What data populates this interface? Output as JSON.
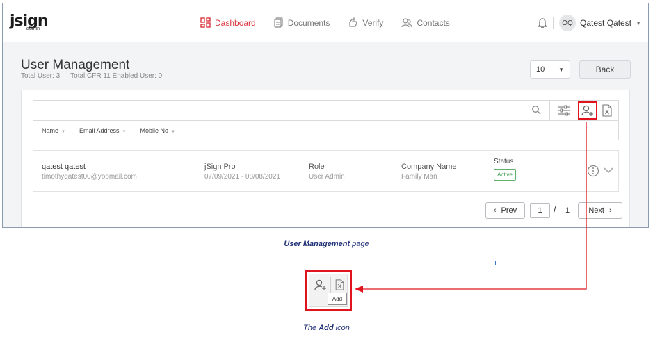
{
  "app": {
    "logo": "jsign",
    "logo_sub": "admin"
  },
  "nav": {
    "items": [
      {
        "label": "Dashboard",
        "icon": "dashboard-grid-icon",
        "active": true
      },
      {
        "label": "Documents",
        "icon": "documents-icon",
        "active": false
      },
      {
        "label": "Verify",
        "icon": "verify-hand-icon",
        "active": false
      },
      {
        "label": "Contacts",
        "icon": "contacts-icon",
        "active": false
      }
    ]
  },
  "user_menu": {
    "initials": "QQ",
    "name": "Qatest Qatest"
  },
  "page": {
    "title": "User Management",
    "total_users": "Total User: 3",
    "total_cfr": "Total CFR 11 Enabled User: 0",
    "page_size": "10",
    "back_label": "Back"
  },
  "toolbar": {
    "sort_fields": [
      "Name",
      "Email Address",
      "Mobile No"
    ]
  },
  "users": [
    {
      "name": "qatest qatest",
      "email": "timothyqatest00@yopmail.com",
      "plan": "jSign Pro",
      "period": "07/09/2021 - 08/08/2021",
      "role_label": "Role",
      "role": "User Admin",
      "company_label": "Company Name",
      "company": "Family Man",
      "status_label": "Status",
      "status": "Active"
    }
  ],
  "pager": {
    "prev_label": "Prev",
    "current": "1",
    "slash": "/",
    "total": "1",
    "next_label": "Next"
  },
  "annotations": {
    "caption1_bold": "User Management",
    "caption1_rest": " page",
    "tooltip": "Add",
    "caption2_pre": "The ",
    "caption2_bold": "Add",
    "caption2_rest": " icon"
  },
  "colors": {
    "accent_red": "#d9363e",
    "highlight_red": "#e0141e",
    "caption_blue": "#1f2f76",
    "status_green": "#3a9a4f"
  }
}
